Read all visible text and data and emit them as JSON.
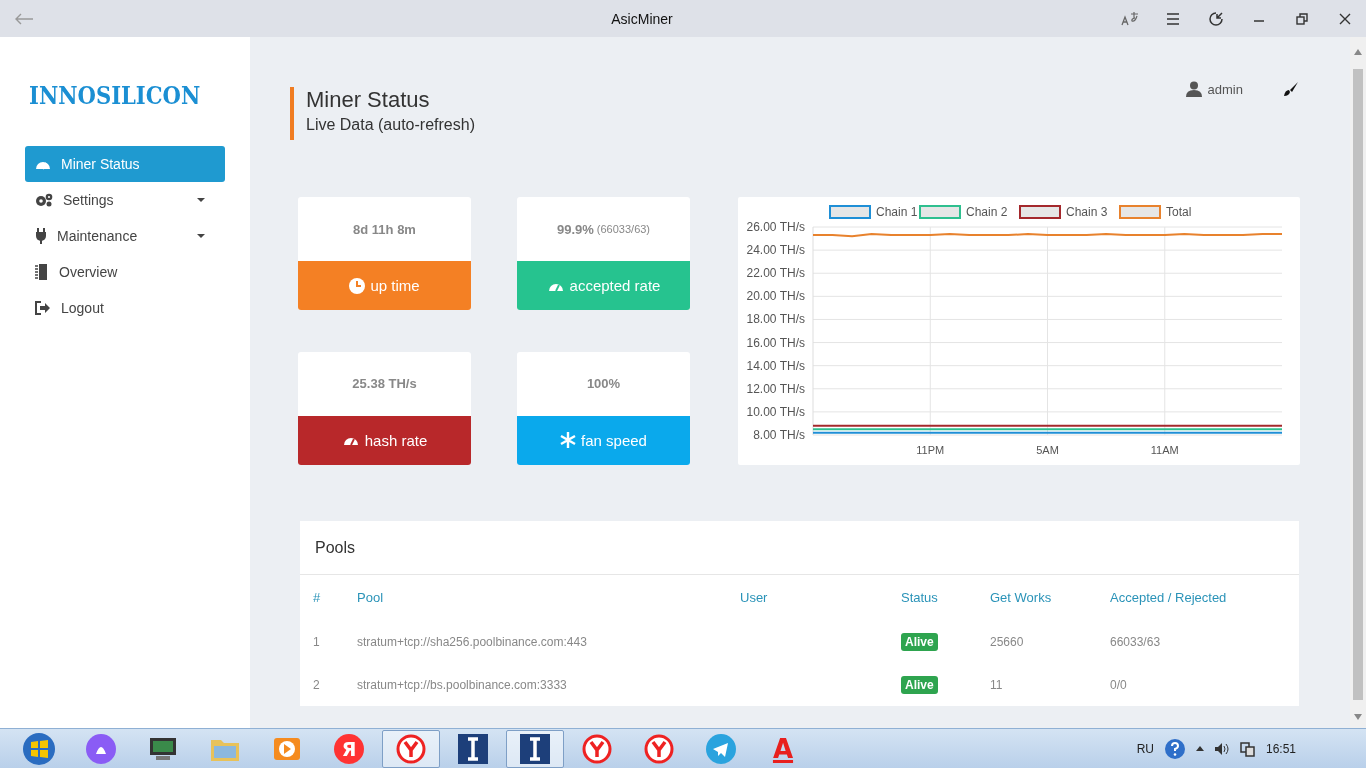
{
  "window": {
    "title": "AsicMiner"
  },
  "logo": "INNOSILICON",
  "sidebar": {
    "items": [
      {
        "label": "Miner Status",
        "kind": "link",
        "selected": true
      },
      {
        "label": "Settings",
        "kind": "dropdown",
        "selected": false
      },
      {
        "label": "Maintenance",
        "kind": "dropdown",
        "selected": false
      },
      {
        "label": "Overview",
        "kind": "link",
        "selected": false
      },
      {
        "label": "Logout",
        "kind": "link",
        "selected": false
      }
    ]
  },
  "header": {
    "title": "Miner Status",
    "subtitle": "Live Data (auto-refresh)",
    "user": "admin"
  },
  "stat_cards": [
    {
      "value": "8d 11h 8m",
      "label": "up time",
      "color": "#f48024"
    },
    {
      "value": "99.9%",
      "detail": "(66033/63)",
      "label": "accepted rate",
      "color": "#26c38f"
    },
    {
      "value": "25.38 TH/s",
      "label": "hash rate",
      "color": "#b8282a"
    },
    {
      "value": "100%",
      "label": "fan speed",
      "color": "#0aa9ec"
    }
  ],
  "chart_data": {
    "type": "line",
    "categories": [
      null,
      null,
      null,
      null,
      null,
      null,
      "11PM",
      null,
      null,
      null,
      null,
      null,
      "5AM",
      null,
      null,
      null,
      null,
      null,
      "11AM",
      null,
      null,
      null,
      null,
      null,
      null
    ],
    "ylim": [
      8,
      26
    ],
    "grid": true,
    "legend": true,
    "yticks": [
      {
        "value": 8,
        "label": "8.00 TH/s"
      },
      {
        "value": 10,
        "label": "10.00 TH/s"
      },
      {
        "value": 12,
        "label": "12.00 TH/s"
      },
      {
        "value": 14,
        "label": "14.00 TH/s"
      },
      {
        "value": 16,
        "label": "16.00 TH/s"
      },
      {
        "value": 18,
        "label": "18.00 TH/s"
      },
      {
        "value": 20,
        "label": "20.00 TH/s"
      },
      {
        "value": 22,
        "label": "22.00 TH/s"
      },
      {
        "value": 24,
        "label": "24.00 TH/s"
      },
      {
        "value": 26,
        "label": "26.00 TH/s"
      }
    ],
    "series": [
      {
        "name": "Chain 1",
        "color": "#1f8fd6",
        "values": [
          8.2,
          8.2,
          8.2,
          8.2,
          8.2,
          8.2,
          8.2,
          8.2,
          8.2,
          8.2,
          8.2,
          8.2,
          8.2,
          8.2,
          8.2,
          8.2,
          8.2,
          8.2,
          8.2,
          8.2,
          8.2,
          8.2,
          8.2,
          8.2,
          8.2
        ]
      },
      {
        "name": "Chain 2",
        "color": "#2fbf8f",
        "values": [
          8.5,
          8.5,
          8.5,
          8.5,
          8.5,
          8.5,
          8.5,
          8.5,
          8.5,
          8.5,
          8.5,
          8.5,
          8.5,
          8.5,
          8.5,
          8.5,
          8.5,
          8.5,
          8.5,
          8.5,
          8.5,
          8.5,
          8.5,
          8.5,
          8.5
        ]
      },
      {
        "name": "Chain 3",
        "color": "#a4282c",
        "values": [
          8.8,
          8.8,
          8.8,
          8.8,
          8.8,
          8.8,
          8.8,
          8.8,
          8.8,
          8.8,
          8.8,
          8.8,
          8.8,
          8.8,
          8.8,
          8.8,
          8.8,
          8.8,
          8.8,
          8.8,
          8.8,
          8.8,
          8.8,
          8.8,
          8.8
        ]
      },
      {
        "name": "Total",
        "color": "#e8822d",
        "values": [
          25.3,
          25.3,
          25.2,
          25.4,
          25.3,
          25.3,
          25.3,
          25.4,
          25.3,
          25.3,
          25.3,
          25.4,
          25.3,
          25.3,
          25.3,
          25.4,
          25.3,
          25.3,
          25.3,
          25.4,
          25.3,
          25.3,
          25.3,
          25.4,
          25.4
        ]
      }
    ]
  },
  "pools": {
    "title": "Pools",
    "columns": [
      "#",
      "Pool",
      "User",
      "Status",
      "Get Works",
      "Accepted / Rejected"
    ],
    "rows": [
      {
        "index": "1",
        "pool": "stratum+tcp://sha256.poolbinance.com:443",
        "status": "Alive",
        "get_works": "25660",
        "accepted_rejected": "66033/63"
      },
      {
        "index": "2",
        "pool": "stratum+tcp://bs.poolbinance.com:3333",
        "status": "Alive",
        "get_works": "11",
        "accepted_rejected": "0/0"
      }
    ]
  },
  "taskbar": {
    "letter_icons": [
      "Я",
      "А"
    ],
    "language": "RU",
    "time": "16:51"
  }
}
